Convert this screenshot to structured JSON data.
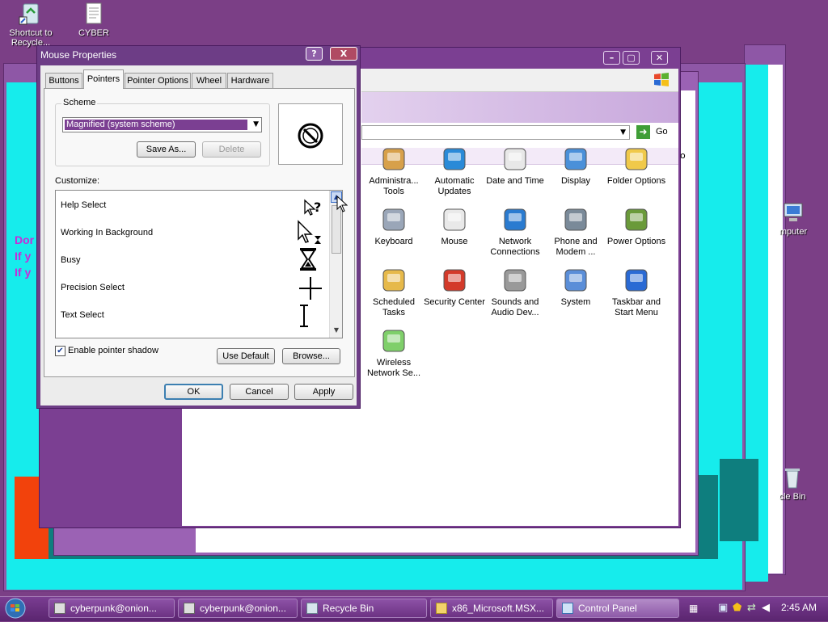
{
  "desktop": {
    "icons": [
      {
        "label": "Shortcut to Recycle...",
        "icon": "recycle-shortcut-icon"
      },
      {
        "label": "CYBER",
        "icon": "document-icon"
      },
      {
        "label": "mputer",
        "icon": "computer-icon"
      },
      {
        "label": "cle Bin",
        "icon": "recycle-bin-icon"
      }
    ],
    "background_text": [
      "Dor",
      "If y",
      "If y"
    ]
  },
  "control_panel": {
    "go_label": "Go",
    "column_fragment": "o",
    "icons": [
      {
        "label": "Administra... Tools",
        "icon": "admin-tools-icon"
      },
      {
        "label": "Automatic Updates",
        "icon": "windows-update-icon"
      },
      {
        "label": "Date and Time",
        "icon": "clock-icon"
      },
      {
        "label": "Display",
        "icon": "display-icon"
      },
      {
        "label": "Folder Options",
        "icon": "folder-options-icon"
      },
      {
        "label": "Keyboard",
        "icon": "keyboard-icon"
      },
      {
        "label": "Mouse",
        "icon": "mouse-icon"
      },
      {
        "label": "Network Connections",
        "icon": "network-icon"
      },
      {
        "label": "Phone and Modem ...",
        "icon": "phone-icon"
      },
      {
        "label": "Power Options",
        "icon": "power-icon"
      },
      {
        "label": "Scheduled Tasks",
        "icon": "scheduled-tasks-icon"
      },
      {
        "label": "Security Center",
        "icon": "shield-icon"
      },
      {
        "label": "Sounds and Audio Dev...",
        "icon": "speaker-icon"
      },
      {
        "label": "System",
        "icon": "system-icon"
      },
      {
        "label": "Taskbar and Start Menu",
        "icon": "taskbar-icon"
      },
      {
        "label": "Wireless Network Se...",
        "icon": "wireless-icon"
      }
    ]
  },
  "dialog": {
    "title": "Mouse Properties",
    "help_btn": "?",
    "close_btn": "X",
    "tabs": [
      "Buttons",
      "Pointers",
      "Pointer Options",
      "Wheel",
      "Hardware"
    ],
    "selected_tab": "Pointers",
    "scheme_label": "Scheme",
    "scheme_value": "Magnified (system scheme)",
    "save_as": "Save As...",
    "delete": "Delete",
    "customize_label": "Customize:",
    "pointers": [
      {
        "name": "Help Select",
        "icon": "help-select-cursor-icon"
      },
      {
        "name": "Working In Background",
        "icon": "working-background-cursor-icon"
      },
      {
        "name": "Busy",
        "icon": "hourglass-icon"
      },
      {
        "name": "Precision Select",
        "icon": "crosshair-icon"
      },
      {
        "name": "Text Select",
        "icon": "ibeam-icon"
      }
    ],
    "shadow_label": "Enable pointer shadow",
    "shadow_checked": true,
    "use_default": "Use Default",
    "browse": "Browse...",
    "ok": "OK",
    "cancel": "Cancel",
    "apply": "Apply"
  },
  "taskbar": {
    "buttons": [
      {
        "label": "cyberpunk@onion...",
        "active": false
      },
      {
        "label": "cyberpunk@onion...",
        "active": false
      },
      {
        "label": "Recycle Bin",
        "active": false
      },
      {
        "label": "x86_Microsoft.MSX...",
        "active": false
      },
      {
        "label": "Control Panel",
        "active": true
      }
    ],
    "clock": "2:45 AM"
  }
}
